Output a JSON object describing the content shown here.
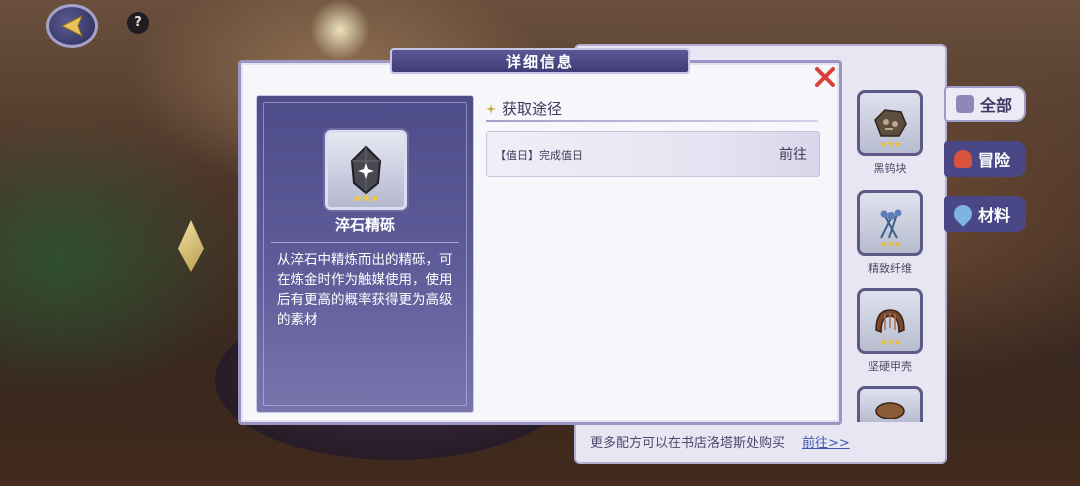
{
  "dialog": {
    "title": "详细信息",
    "close_icon": "close-x-icon"
  },
  "item_detail": {
    "name": "淬石精砾",
    "stars": "★★★",
    "description": "从淬石中精炼而出的精砾，可在炼金时作为触媒使用，使用后有更高的概率获得更为高级的素材"
  },
  "acquisition": {
    "title": "获取途径",
    "sources": [
      {
        "text": "【值日】完成值日",
        "action": "前往"
      }
    ]
  },
  "side_panel": {
    "items": [
      {
        "name": "黑钨块",
        "stars": "★★★"
      },
      {
        "name": "精致纤维",
        "stars": "★★★"
      },
      {
        "name": "坚硬甲壳",
        "stars": "★★★"
      }
    ],
    "tabs": [
      {
        "label": "全部",
        "icon": "bag-icon"
      },
      {
        "label": "冒险",
        "icon": "potion-icon"
      },
      {
        "label": "材料",
        "icon": "droplet-icon"
      }
    ],
    "footer_hint": "更多配方可以在书店洛塔斯处购买",
    "footer_link": "前往>>"
  },
  "hud": {
    "help_label": "?"
  },
  "colors": {
    "accent": "#4a4786",
    "close": "#d9403a",
    "star": "#f1c934"
  }
}
